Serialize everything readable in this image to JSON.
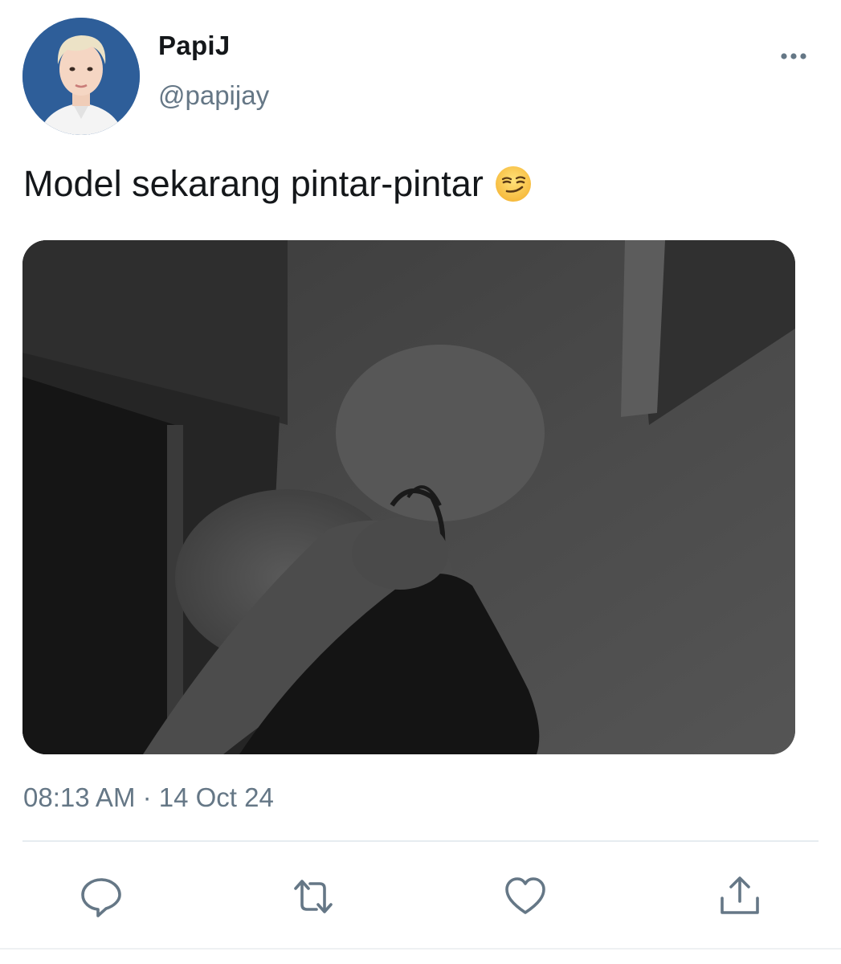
{
  "tweet": {
    "author": {
      "display_name": "PapiJ",
      "handle": "@papijay"
    },
    "text": "Model sekarang pintar-pintar",
    "emoji": "smirking-face",
    "timestamp": "08:13 AM · 14 Oct 24"
  },
  "actions": {
    "reply_icon": "reply-icon",
    "retweet_icon": "retweet-icon",
    "like_icon": "heart-icon",
    "share_icon": "share-icon"
  },
  "colors": {
    "text_primary": "#14171a",
    "text_secondary": "#657786",
    "icon": "#657786",
    "divider": "#e6ecf0"
  }
}
